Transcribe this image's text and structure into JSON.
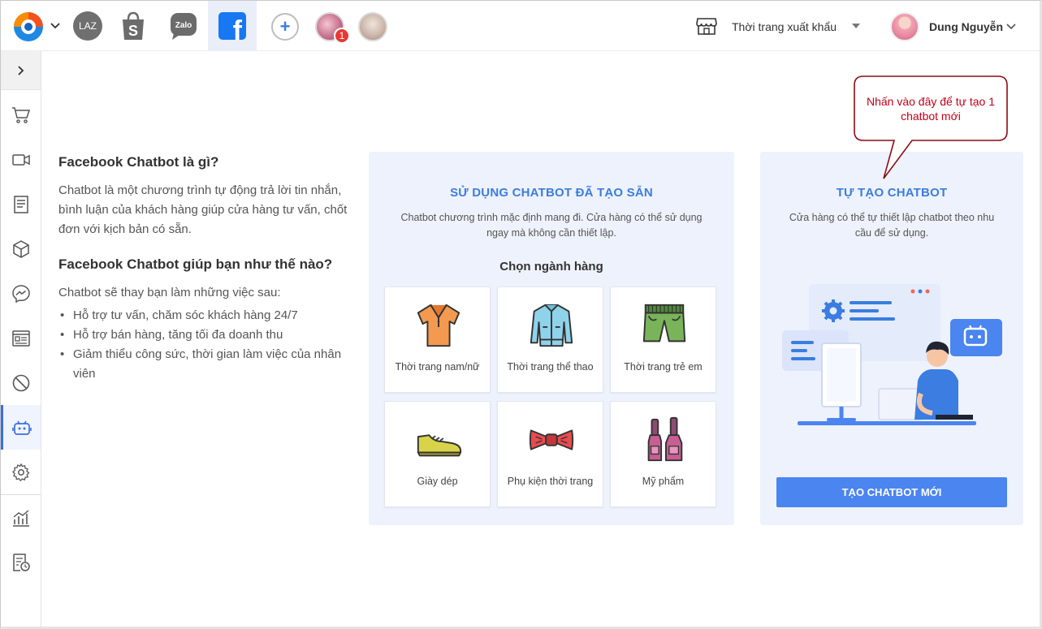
{
  "topbar": {
    "laz_label": "LAZ",
    "shopee_label": "S",
    "zalo_label": "Zalo",
    "fb_label": "f",
    "add_label": "+",
    "notification_count": "1",
    "shop_name": "Thời trang xuất khẩu",
    "user_name": "Dung Nguyễn"
  },
  "sidebar": {
    "items": [
      "cart-icon",
      "video-icon",
      "order-icon",
      "box-icon",
      "messenger-icon",
      "profile-card-icon",
      "block-icon",
      "robot-icon",
      "settings-icon",
      "chart-icon",
      "report-icon"
    ],
    "active": "robot-icon"
  },
  "intro": {
    "heading1": "Facebook Chatbot là gì?",
    "para1": "Chatbot là một chương trình tự động trả lời tin nhắn, bình luận của khách hàng giúp cửa hàng tư vấn, chốt đơn với kịch bản có sẵn.",
    "heading2": "Facebook Chatbot giúp bạn như thế nào?",
    "para2": "Chatbot sẽ thay bạn làm những việc sau:",
    "bullets": [
      "Hỗ trợ tư vấn, chăm sóc khách hàng 24/7",
      "Hỗ trợ bán hàng, tăng tối đa doanh thu",
      "Giảm thiểu công sức, thời gian làm việc của nhân viên"
    ]
  },
  "preset": {
    "title": "SỬ DỤNG CHATBOT ĐÃ TẠO SẴN",
    "desc": "Chatbot chương trình mặc định mang đi. Cửa hàng có thể sử dụng ngay mà không cần thiết lập.",
    "choose_label": "Chọn ngành hàng",
    "categories": [
      {
        "label": "Thời trang nam/nữ",
        "icon": "shirt-icon"
      },
      {
        "label": "Thời trang thể thao",
        "icon": "jacket-icon"
      },
      {
        "label": "Thời trang trẻ em",
        "icon": "shorts-icon"
      },
      {
        "label": "Giày dép",
        "icon": "shoe-icon"
      },
      {
        "label": "Phụ kiện thời trang",
        "icon": "bowtie-icon"
      },
      {
        "label": "Mỹ phẩm",
        "icon": "nail-polish-icon"
      }
    ]
  },
  "custom": {
    "title": "TỰ TẠO CHATBOT",
    "desc": "Cửa hàng có thể tự thiết lập chatbot theo nhu cầu để sử dụng.",
    "button_label": "TẠO CHATBOT MỚI"
  },
  "callout": {
    "text": "Nhấn vào đây để tự tạo 1 chatbot mới"
  },
  "colors": {
    "accent": "#3b7de0",
    "button": "#4a85f0",
    "panel_bg": "#eef2fc",
    "callout_text": "#c0001a"
  }
}
